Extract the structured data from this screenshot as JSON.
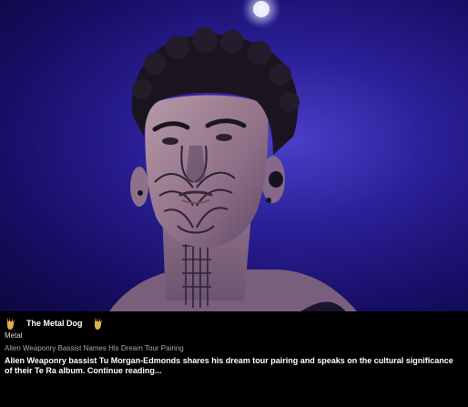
{
  "hero": {
    "image_name": "alien-weaponry-bassist-photo"
  },
  "source": {
    "name": "The Metal Dog",
    "icon": "horns-icon",
    "icon_color": "#e2b04a"
  },
  "category": "Metal",
  "headline": "Alien Weaponry Bassist Names His Dream Tour Pairing",
  "summary": {
    "text": "Alien Weaponry bassist Tu Morgan-Edmonds shares his dream tour pairing and speaks on the cultural significance of their Te Ra album.",
    "more_label": "Continue reading..."
  },
  "colors": {
    "background": "#000000",
    "stage_blue": "#2b1f97",
    "text": "#ffffff",
    "muted": "#a8a8a8"
  }
}
